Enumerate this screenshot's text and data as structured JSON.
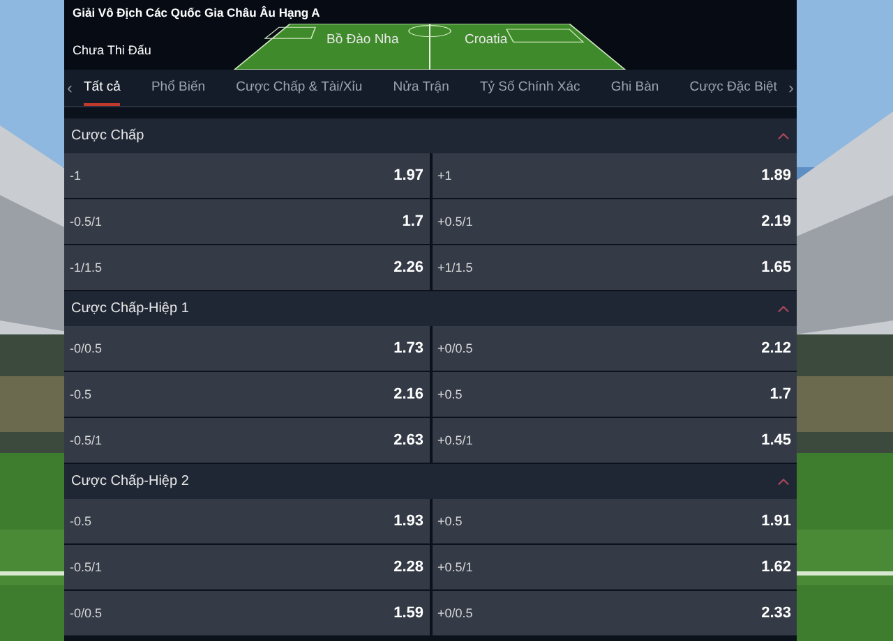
{
  "match": {
    "league": "Giải Vô Địch Các Quốc Gia Châu Âu Hạng A",
    "status": "Chưa Thi Đấu",
    "home": "Bồ Đào Nha",
    "away": "Croatia"
  },
  "tab_bar": {
    "prev": "‹",
    "next": "›",
    "tabs": [
      {
        "label": "Tất cả",
        "selected": true
      },
      {
        "label": "Phổ Biến",
        "selected": false
      },
      {
        "label": "Cược Chấp & Tài/Xỉu",
        "selected": false
      },
      {
        "label": "Nửa Trận",
        "selected": false
      },
      {
        "label": "Tỷ Số Chính Xác",
        "selected": false
      },
      {
        "label": "Ghi Bàn",
        "selected": false
      },
      {
        "label": "Cược Đặc Biệt",
        "selected": false
      }
    ]
  },
  "markets": [
    {
      "title": "Cược Chấp",
      "expanded": true,
      "rows": [
        [
          {
            "label": "-1",
            "odds": "1.97"
          },
          {
            "label": "+1",
            "odds": "1.89"
          }
        ],
        [
          {
            "label": "-0.5/1",
            "odds": "1.7"
          },
          {
            "label": "+0.5/1",
            "odds": "2.19"
          }
        ],
        [
          {
            "label": "-1/1.5",
            "odds": "2.26"
          },
          {
            "label": "+1/1.5",
            "odds": "1.65"
          }
        ]
      ]
    },
    {
      "title": "Cược Chấp-Hiệp 1",
      "expanded": true,
      "rows": [
        [
          {
            "label": "-0/0.5",
            "odds": "1.73"
          },
          {
            "label": "+0/0.5",
            "odds": "2.12"
          }
        ],
        [
          {
            "label": "-0.5",
            "odds": "2.16"
          },
          {
            "label": "+0.5",
            "odds": "1.7"
          }
        ],
        [
          {
            "label": "-0.5/1",
            "odds": "2.63"
          },
          {
            "label": "+0.5/1",
            "odds": "1.45"
          }
        ]
      ]
    },
    {
      "title": "Cược Chấp-Hiệp 2",
      "expanded": true,
      "rows": [
        [
          {
            "label": "-0.5",
            "odds": "1.93"
          },
          {
            "label": "+0.5",
            "odds": "1.91"
          }
        ],
        [
          {
            "label": "-0.5/1",
            "odds": "2.28"
          },
          {
            "label": "+0.5/1",
            "odds": "1.62"
          }
        ],
        [
          {
            "label": "-0/0.5",
            "odds": "1.59"
          },
          {
            "label": "+0/0.5",
            "odds": "2.33"
          }
        ]
      ]
    }
  ]
}
